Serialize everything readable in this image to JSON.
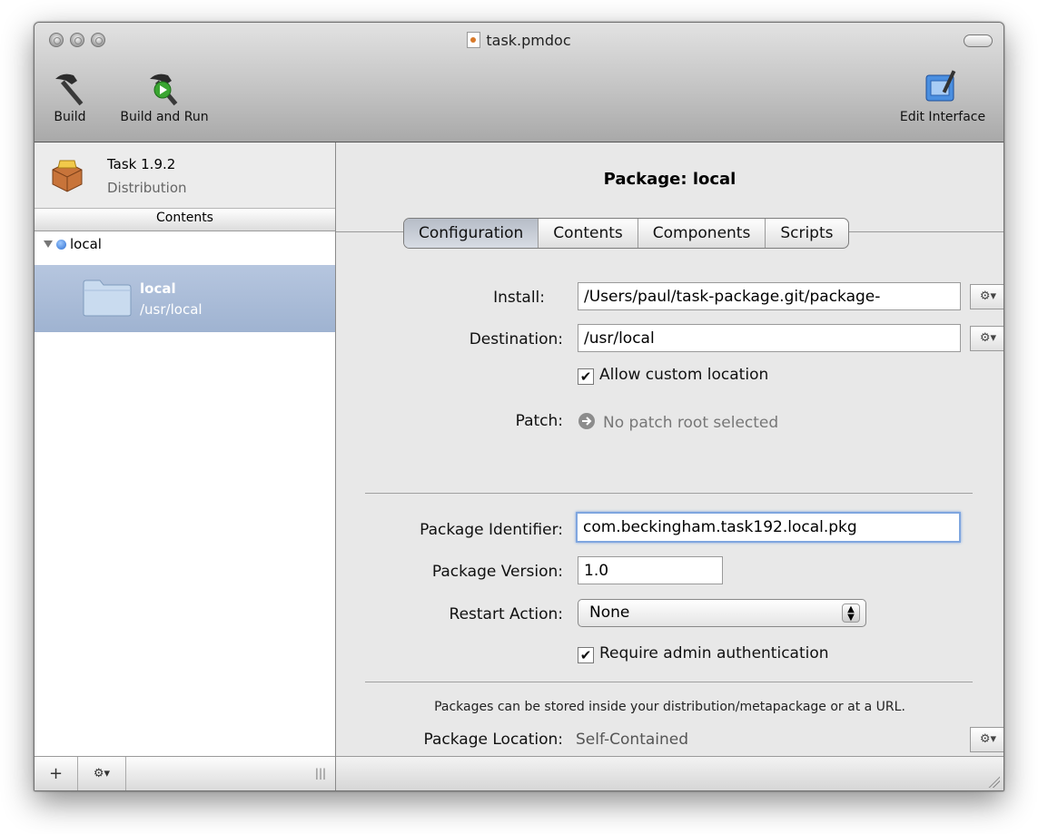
{
  "window": {
    "title": "task.pmdoc"
  },
  "toolbar": {
    "build_label": "Build",
    "build_run_label": "Build and Run",
    "edit_interface_label": "Edit Interface"
  },
  "sidebar": {
    "package_name": "Task 1.9.2",
    "package_type": "Distribution",
    "contents_header": "Contents",
    "tree_group": "local",
    "selected_item": {
      "name": "local",
      "path": "/usr/local"
    },
    "add_button": "+",
    "gear_button": "⚙▾",
    "resize_handle": "|||"
  },
  "main": {
    "title": "Package: local",
    "tabs": [
      "Configuration",
      "Contents",
      "Components",
      "Scripts"
    ],
    "active_tab": "Configuration",
    "install": {
      "label": "Install:",
      "value": "/Users/paul/task-package.git/package-"
    },
    "destination": {
      "label": "Destination:",
      "value": "/usr/local"
    },
    "allow_custom_location": {
      "label": "Allow custom location",
      "checked": true
    },
    "patch": {
      "label": "Patch:",
      "value": "No patch root selected"
    },
    "package_identifier": {
      "label": "Package Identifier:",
      "value": "com.beckingham.task192.local.pkg"
    },
    "package_version": {
      "label": "Package Version:",
      "value": "1.0"
    },
    "restart_action": {
      "label": "Restart Action:",
      "value": "None"
    },
    "require_admin": {
      "label": "Require admin authentication",
      "checked": true
    },
    "info_text": "Packages can be stored inside your distribution/metapackage or at a URL.",
    "package_location": {
      "label": "Package Location:",
      "value": "Self-Contained"
    },
    "gear_button": "⚙▾"
  }
}
